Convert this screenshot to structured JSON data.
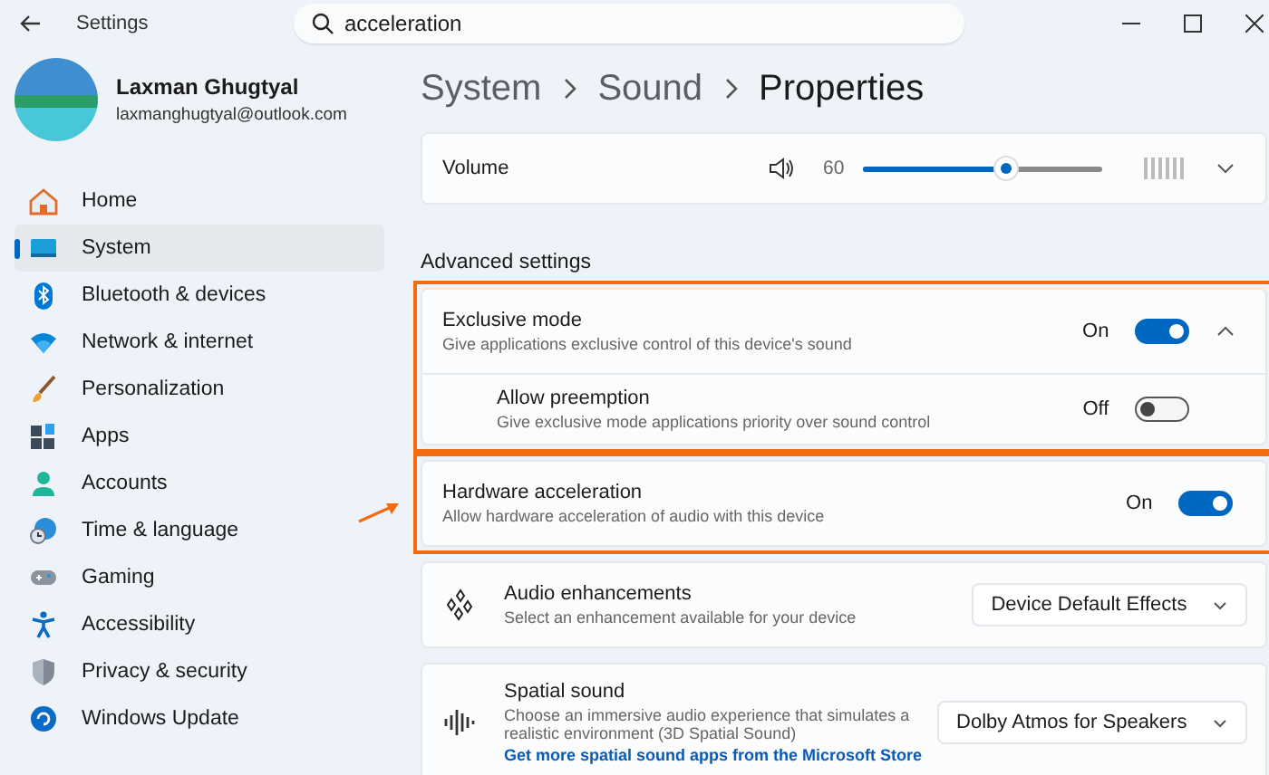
{
  "window": {
    "title": "Settings"
  },
  "search": {
    "value": "acceleration"
  },
  "account": {
    "name": "Laxman Ghugtyal",
    "email": "laxmanghugtyal@outlook.com"
  },
  "sidebar": {
    "items": [
      {
        "label": "Home",
        "selected": false
      },
      {
        "label": "System",
        "selected": true
      },
      {
        "label": "Bluetooth & devices",
        "selected": false
      },
      {
        "label": "Network & internet",
        "selected": false
      },
      {
        "label": "Personalization",
        "selected": false
      },
      {
        "label": "Apps",
        "selected": false
      },
      {
        "label": "Accounts",
        "selected": false
      },
      {
        "label": "Time & language",
        "selected": false
      },
      {
        "label": "Gaming",
        "selected": false
      },
      {
        "label": "Accessibility",
        "selected": false
      },
      {
        "label": "Privacy & security",
        "selected": false
      },
      {
        "label": "Windows Update",
        "selected": false
      }
    ]
  },
  "breadcrumb": [
    "System",
    "Sound",
    "Properties"
  ],
  "volume": {
    "label": "Volume",
    "reading": "60",
    "level": 0.6,
    "expanded": false
  },
  "advanced_heading": "Advanced settings",
  "settings": [
    {
      "kind": "toggle",
      "title": "Exclusive mode",
      "description": "Give applications exclusive control of this device's sound",
      "state_label": "On",
      "on": true,
      "expanded": true,
      "highlighted": true,
      "pointer_arrow": false,
      "children": [
        {
          "kind": "toggle",
          "title": "Allow preemption",
          "description": "Give exclusive mode applications priority over sound control",
          "state_label": "Off",
          "on": false
        }
      ]
    },
    {
      "kind": "toggle",
      "title": "Hardware acceleration",
      "description": "Allow hardware acceleration of audio with this device",
      "state_label": "On",
      "on": true,
      "highlighted": true,
      "pointer_arrow": true
    },
    {
      "kind": "dropdown",
      "title": "Audio enhancements",
      "description": "Select an enhancement available for your device",
      "value": "Device Default Effects",
      "highlighted": false,
      "pointer_arrow": false
    },
    {
      "kind": "dropdown",
      "title": "Spatial sound",
      "description": "Choose an immersive audio experience that simulates a realistic environment (3D Spatial Sound)",
      "link": "Get more spatial sound apps from the Microsoft Store",
      "value": "Dolby Atmos for Speakers",
      "highlighted": false,
      "pointer_arrow": false
    }
  ]
}
